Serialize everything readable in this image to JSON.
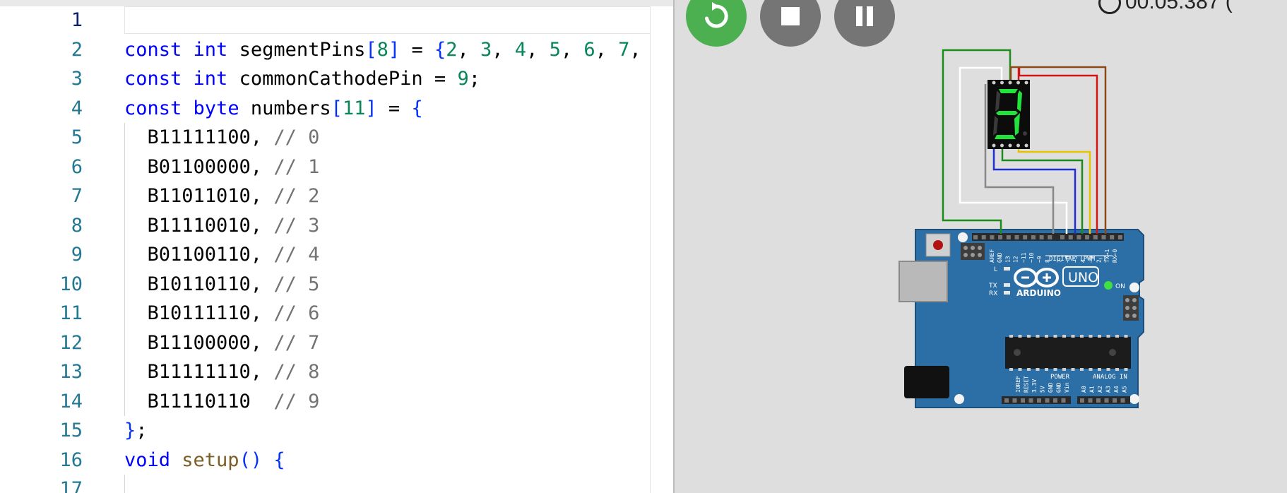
{
  "editor": {
    "current_line": 1,
    "lines": [
      {
        "num": "1",
        "tokens": []
      },
      {
        "num": "2",
        "tokens": [
          {
            "t": "const ",
            "c": "tk-kw"
          },
          {
            "t": "int ",
            "c": "tk-kw"
          },
          {
            "t": "segmentPins",
            "c": "tk-plain"
          },
          {
            "t": "[",
            "c": "tk-br"
          },
          {
            "t": "8",
            "c": "tk-num"
          },
          {
            "t": "]",
            "c": "tk-br"
          },
          {
            "t": " = ",
            "c": "tk-plain"
          },
          {
            "t": "{",
            "c": "tk-br"
          },
          {
            "t": "2",
            "c": "tk-num"
          },
          {
            "t": ", ",
            "c": "tk-plain"
          },
          {
            "t": "3",
            "c": "tk-num"
          },
          {
            "t": ", ",
            "c": "tk-plain"
          },
          {
            "t": "4",
            "c": "tk-num"
          },
          {
            "t": ", ",
            "c": "tk-plain"
          },
          {
            "t": "5",
            "c": "tk-num"
          },
          {
            "t": ", ",
            "c": "tk-plain"
          },
          {
            "t": "6",
            "c": "tk-num"
          },
          {
            "t": ", ",
            "c": "tk-plain"
          },
          {
            "t": "7",
            "c": "tk-num"
          },
          {
            "t": ",",
            "c": "tk-plain"
          }
        ]
      },
      {
        "num": "3",
        "tokens": [
          {
            "t": "const ",
            "c": "tk-kw"
          },
          {
            "t": "int ",
            "c": "tk-kw"
          },
          {
            "t": "commonCathodePin = ",
            "c": "tk-plain"
          },
          {
            "t": "9",
            "c": "tk-num"
          },
          {
            "t": ";",
            "c": "tk-plain"
          }
        ]
      },
      {
        "num": "4",
        "tokens": [
          {
            "t": "const ",
            "c": "tk-kw"
          },
          {
            "t": "byte ",
            "c": "tk-kw"
          },
          {
            "t": "numbers",
            "c": "tk-plain"
          },
          {
            "t": "[",
            "c": "tk-br"
          },
          {
            "t": "11",
            "c": "tk-num"
          },
          {
            "t": "]",
            "c": "tk-br"
          },
          {
            "t": " = ",
            "c": "tk-plain"
          },
          {
            "t": "{",
            "c": "tk-br"
          }
        ]
      },
      {
        "num": "5",
        "indent": true,
        "tokens": [
          {
            "t": "  B11111100, ",
            "c": "tk-plain"
          },
          {
            "t": "// 0",
            "c": "tk-cm"
          }
        ]
      },
      {
        "num": "6",
        "indent": true,
        "tokens": [
          {
            "t": "  B01100000, ",
            "c": "tk-plain"
          },
          {
            "t": "// 1",
            "c": "tk-cm"
          }
        ]
      },
      {
        "num": "7",
        "indent": true,
        "tokens": [
          {
            "t": "  B11011010, ",
            "c": "tk-plain"
          },
          {
            "t": "// 2",
            "c": "tk-cm"
          }
        ]
      },
      {
        "num": "8",
        "indent": true,
        "tokens": [
          {
            "t": "  B11110010, ",
            "c": "tk-plain"
          },
          {
            "t": "// 3",
            "c": "tk-cm"
          }
        ]
      },
      {
        "num": "9",
        "indent": true,
        "tokens": [
          {
            "t": "  B01100110, ",
            "c": "tk-plain"
          },
          {
            "t": "// 4",
            "c": "tk-cm"
          }
        ]
      },
      {
        "num": "10",
        "indent": true,
        "tokens": [
          {
            "t": "  B10110110, ",
            "c": "tk-plain"
          },
          {
            "t": "// 5",
            "c": "tk-cm"
          }
        ]
      },
      {
        "num": "11",
        "indent": true,
        "tokens": [
          {
            "t": "  B10111110, ",
            "c": "tk-plain"
          },
          {
            "t": "// 6",
            "c": "tk-cm"
          }
        ]
      },
      {
        "num": "12",
        "indent": true,
        "tokens": [
          {
            "t": "  B11100000, ",
            "c": "tk-plain"
          },
          {
            "t": "// 7",
            "c": "tk-cm"
          }
        ]
      },
      {
        "num": "13",
        "indent": true,
        "tokens": [
          {
            "t": "  B11111110, ",
            "c": "tk-plain"
          },
          {
            "t": "// 8",
            "c": "tk-cm"
          }
        ]
      },
      {
        "num": "14",
        "indent": true,
        "tokens": [
          {
            "t": "  B11110110  ",
            "c": "tk-plain"
          },
          {
            "t": "// 9",
            "c": "tk-cm"
          }
        ]
      },
      {
        "num": "15",
        "tokens": [
          {
            "t": "}",
            "c": "tk-br"
          },
          {
            "t": ";",
            "c": "tk-plain"
          }
        ]
      },
      {
        "num": "16",
        "tokens": [
          {
            "t": "void ",
            "c": "tk-kw"
          },
          {
            "t": "setup",
            "c": "tk-fn"
          },
          {
            "t": "()",
            "c": "tk-br"
          },
          {
            "t": " ",
            "c": "tk-plain"
          },
          {
            "t": "{",
            "c": "tk-br"
          }
        ]
      },
      {
        "num": "17",
        "indent": true,
        "tokens": []
      }
    ]
  },
  "simulator": {
    "timer_text": "00:05.387 (",
    "controls": {
      "restart_icon": "restart-icon",
      "stop_icon": "stop-icon",
      "pause_icon": "pause-icon"
    },
    "seven_segment": {
      "digit_shown": "3",
      "on_color": "#22e33b",
      "off_color": "#3a3a3a"
    },
    "board": {
      "brand": "ARDUINO",
      "model": "UNO",
      "on_label": "ON",
      "digital_label": "DIGITAL (PWM ~)",
      "power_label": "POWER",
      "analog_label": "ANALOG IN",
      "left_labels": [
        "L",
        "TX",
        "RX"
      ],
      "top_pin_labels": [
        "AREF",
        "GND",
        "13",
        "12",
        "~11",
        "~10",
        "~9",
        "8",
        "7",
        "~6",
        "~5",
        "4",
        "~3",
        "2",
        "TX→1",
        "RX←0"
      ],
      "power_pin_labels": [
        "IOREF",
        "RESET",
        "3.3V",
        "5V",
        "GND",
        "GND",
        "Vin"
      ],
      "analog_pin_labels": [
        "A0",
        "A1",
        "A2",
        "A3",
        "A4",
        "A5"
      ],
      "board_color": "#2c6fa6"
    },
    "wire_colors": [
      "#1a8c1a",
      "#ffffff",
      "#888888",
      "#1f2fd1",
      "#1a8c1a",
      "#e6c300",
      "#d41414",
      "#8b4a14"
    ]
  }
}
